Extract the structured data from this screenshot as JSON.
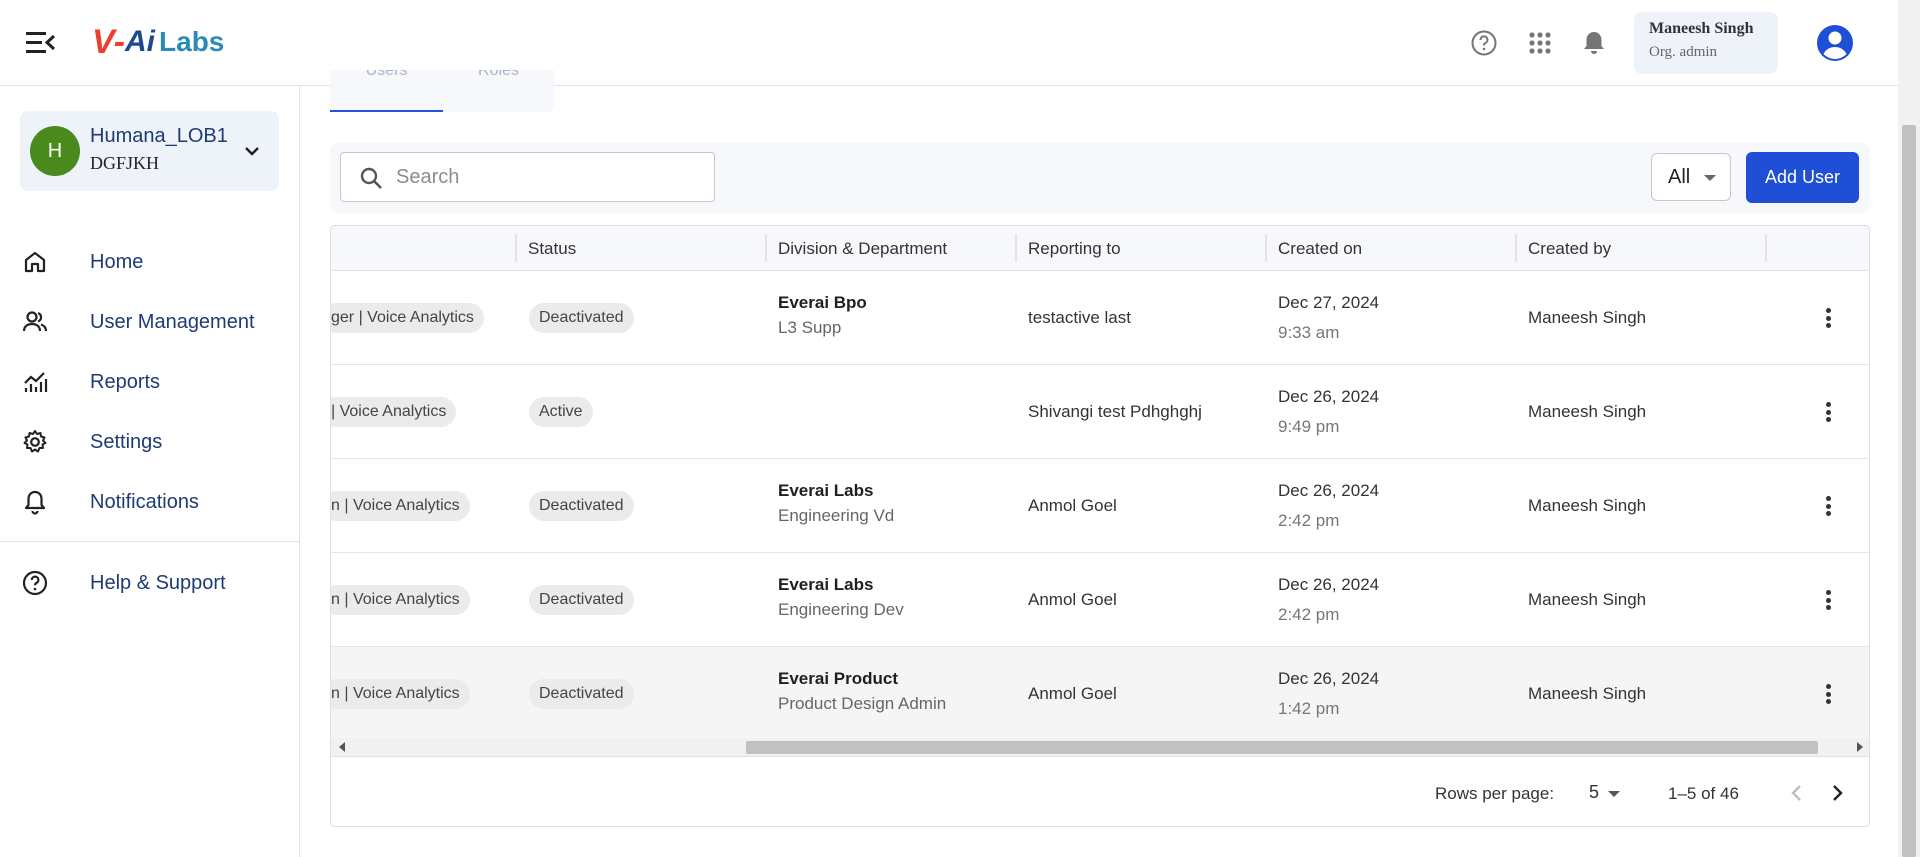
{
  "header": {
    "logo": {
      "v": "V",
      "dash": "-",
      "ai": "Ai",
      "labs": "Labs"
    },
    "user_name": "Maneesh Singh",
    "user_role": "Org. admin",
    "icons": [
      "menu-collapse-icon",
      "help-icon",
      "apps-grid-icon",
      "bell-icon",
      "account-circle-icon"
    ]
  },
  "org": {
    "initial": "H",
    "name": "Humana_LOB1",
    "sub": "DGFJKH"
  },
  "sidebar": {
    "items": [
      {
        "label": "Home",
        "icon": "home-icon"
      },
      {
        "label": "User Management",
        "icon": "users-icon"
      },
      {
        "label": "Reports",
        "icon": "reports-icon"
      },
      {
        "label": "Settings",
        "icon": "gear-icon"
      },
      {
        "label": "Notifications",
        "icon": "bell-icon"
      },
      {
        "label": "Help & Support",
        "icon": "help-icon"
      }
    ]
  },
  "tabs": {
    "users": "Users",
    "roles": "Roles"
  },
  "toolbar": {
    "search_placeholder": "Search",
    "filter_value": "All",
    "add_user_label": "Add User"
  },
  "table": {
    "columns": [
      "Status",
      "Division & Department",
      "Reporting to",
      "Created on",
      "Created by"
    ],
    "rows": [
      {
        "role": "ger | Voice Analytics",
        "status": "Deactivated",
        "division": "Everai Bpo",
        "department": "L3 Supp",
        "reporting_to": "testactive last",
        "created_date": "Dec 27, 2024",
        "created_time": "9:33 am",
        "created_by": "Maneesh Singh"
      },
      {
        "role": "| Voice Analytics",
        "status": "Active",
        "division": "",
        "department": "",
        "reporting_to": "Shivangi test Pdhghghj",
        "created_date": "Dec 26, 2024",
        "created_time": "9:49 pm",
        "created_by": "Maneesh Singh"
      },
      {
        "role": "n | Voice Analytics",
        "status": "Deactivated",
        "division": "Everai Labs",
        "department": "Engineering Vd",
        "reporting_to": "Anmol Goel",
        "created_date": "Dec 26, 2024",
        "created_time": "2:42 pm",
        "created_by": "Maneesh Singh"
      },
      {
        "role": "n | Voice Analytics",
        "status": "Deactivated",
        "division": "Everai Labs",
        "department": "Engineering Dev",
        "reporting_to": "Anmol Goel",
        "created_date": "Dec 26, 2024",
        "created_time": "2:42 pm",
        "created_by": "Maneesh Singh"
      },
      {
        "role": "n | Voice Analytics",
        "status": "Deactivated",
        "division": "Everai Product",
        "department": "Product Design Admin",
        "reporting_to": "Anmol Goel",
        "created_date": "Dec 26, 2024",
        "created_time": "1:42 pm",
        "created_by": "Maneesh Singh"
      }
    ]
  },
  "pagination": {
    "rows_per_page_label": "Rows per page:",
    "rows_per_page_value": "5",
    "range": "1–5 of 46"
  },
  "colors": {
    "primary": "#1f4fd6",
    "org_avatar": "#4a8a1c",
    "nav_text": "#1f3b75"
  }
}
